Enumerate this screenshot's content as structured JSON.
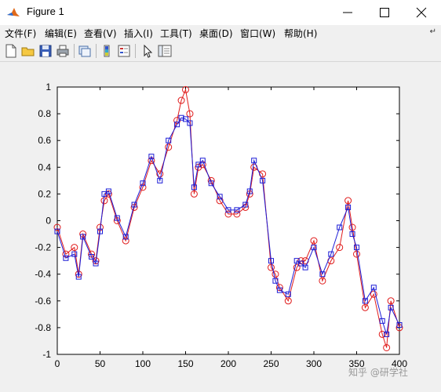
{
  "window": {
    "title": "Figure 1",
    "controls": {
      "minimize": "minimize",
      "maximize": "maximize",
      "close": "close"
    }
  },
  "menu": {
    "items": [
      "文件(F)",
      "编辑(E)",
      "查看(V)",
      "插入(I)",
      "工具(T)",
      "桌面(D)",
      "窗口(W)",
      "帮助(H)"
    ],
    "overflow_icon": "curved-arrow-icon"
  },
  "toolbar": {
    "icons": [
      "new-figure-icon",
      "open-file-icon",
      "save-icon",
      "print-icon",
      "copy-figure-icon",
      "colorbar-icon",
      "legend-icon",
      "pointer-icon",
      "property-editor-icon"
    ]
  },
  "watermark": "知乎 @研学社",
  "colors": {
    "series_red": "#e01b1b",
    "series_blue": "#1b1bd6",
    "axes": "#000000",
    "plot_bg": "#ffffff",
    "figure_bg": "#f0f0f0"
  },
  "chart_data": {
    "type": "line",
    "title": "",
    "xlabel": "",
    "ylabel": "",
    "xlim": [
      0,
      400
    ],
    "ylim": [
      -1,
      1
    ],
    "xticks": [
      0,
      50,
      100,
      150,
      200,
      250,
      300,
      350,
      400
    ],
    "yticks": [
      -1,
      -0.8,
      -0.6,
      -0.4,
      -0.2,
      0,
      0.2,
      0.4,
      0.6,
      0.8,
      1
    ],
    "grid": false,
    "legend": "none",
    "series": [
      {
        "marker": "circle",
        "color": "#e01b1b",
        "x": [
          0,
          10,
          20,
          25,
          30,
          40,
          45,
          50,
          55,
          60,
          70,
          80,
          90,
          100,
          110,
          120,
          130,
          140,
          145,
          150,
          155,
          160,
          165,
          170,
          180,
          190,
          200,
          210,
          220,
          225,
          230,
          240,
          250,
          255,
          260,
          270,
          280,
          285,
          290,
          300,
          310,
          320,
          330,
          340,
          345,
          350,
          360,
          370,
          380,
          385,
          390,
          400
        ],
        "y": [
          -0.05,
          -0.25,
          -0.2,
          -0.4,
          -0.1,
          -0.25,
          -0.3,
          -0.05,
          0.15,
          0.2,
          0.0,
          -0.15,
          0.1,
          0.25,
          0.45,
          0.35,
          0.55,
          0.75,
          0.9,
          0.98,
          0.8,
          0.2,
          0.4,
          0.42,
          0.3,
          0.15,
          0.05,
          0.05,
          0.1,
          0.2,
          0.4,
          0.35,
          -0.35,
          -0.4,
          -0.5,
          -0.6,
          -0.35,
          -0.3,
          -0.3,
          -0.15,
          -0.45,
          -0.3,
          -0.2,
          0.15,
          -0.05,
          -0.25,
          -0.65,
          -0.55,
          -0.85,
          -0.95,
          -0.6,
          -0.8
        ]
      },
      {
        "marker": "square",
        "color": "#1b1bd6",
        "x": [
          0,
          10,
          20,
          25,
          30,
          40,
          45,
          50,
          55,
          60,
          70,
          80,
          90,
          100,
          110,
          120,
          130,
          140,
          145,
          150,
          155,
          160,
          165,
          170,
          180,
          190,
          200,
          210,
          220,
          225,
          230,
          240,
          250,
          255,
          260,
          270,
          280,
          285,
          290,
          300,
          310,
          320,
          330,
          340,
          345,
          350,
          360,
          370,
          380,
          385,
          390,
          400
        ],
        "y": [
          -0.08,
          -0.28,
          -0.25,
          -0.42,
          -0.12,
          -0.27,
          -0.32,
          -0.08,
          0.2,
          0.22,
          0.02,
          -0.12,
          0.12,
          0.28,
          0.48,
          0.3,
          0.6,
          0.72,
          0.77,
          0.76,
          0.73,
          0.25,
          0.42,
          0.45,
          0.28,
          0.18,
          0.08,
          0.08,
          0.12,
          0.22,
          0.45,
          0.3,
          -0.3,
          -0.45,
          -0.52,
          -0.55,
          -0.3,
          -0.32,
          -0.35,
          -0.2,
          -0.4,
          -0.25,
          -0.05,
          0.1,
          -0.1,
          -0.2,
          -0.6,
          -0.5,
          -0.75,
          -0.85,
          -0.65,
          -0.78
        ]
      }
    ]
  }
}
